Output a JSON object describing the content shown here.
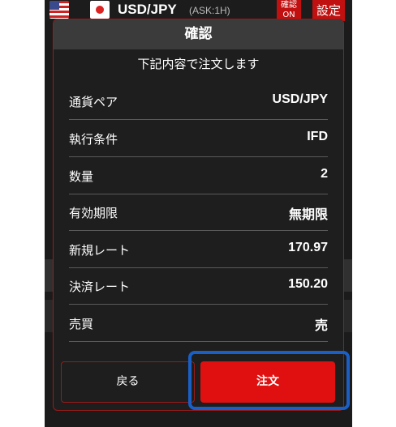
{
  "header": {
    "pair": "USD/JPY",
    "rate_type": "(ASK:1H)",
    "confirm_toggle_line1": "確認",
    "confirm_toggle_line2": "ON",
    "settings_label": "設定"
  },
  "dialog": {
    "title": "確認",
    "subtitle": "下記内容で注文します",
    "rows": [
      {
        "label": "通貨ペア",
        "value": "USD/JPY"
      },
      {
        "label": "執行条件",
        "value": "IFD"
      },
      {
        "label": "数量",
        "value": "2"
      },
      {
        "label": "有効期限",
        "value": "無期限"
      },
      {
        "label": "新規レート",
        "value": "170.97"
      },
      {
        "label": "決済レート",
        "value": "150.20"
      },
      {
        "label": "売買",
        "value": "売"
      }
    ],
    "back_label": "戻る",
    "order_label": "注文"
  },
  "colors": {
    "accent": "#e01010",
    "highlight": "#1a5fc6",
    "dialog_bg": "#1e1e1e"
  }
}
